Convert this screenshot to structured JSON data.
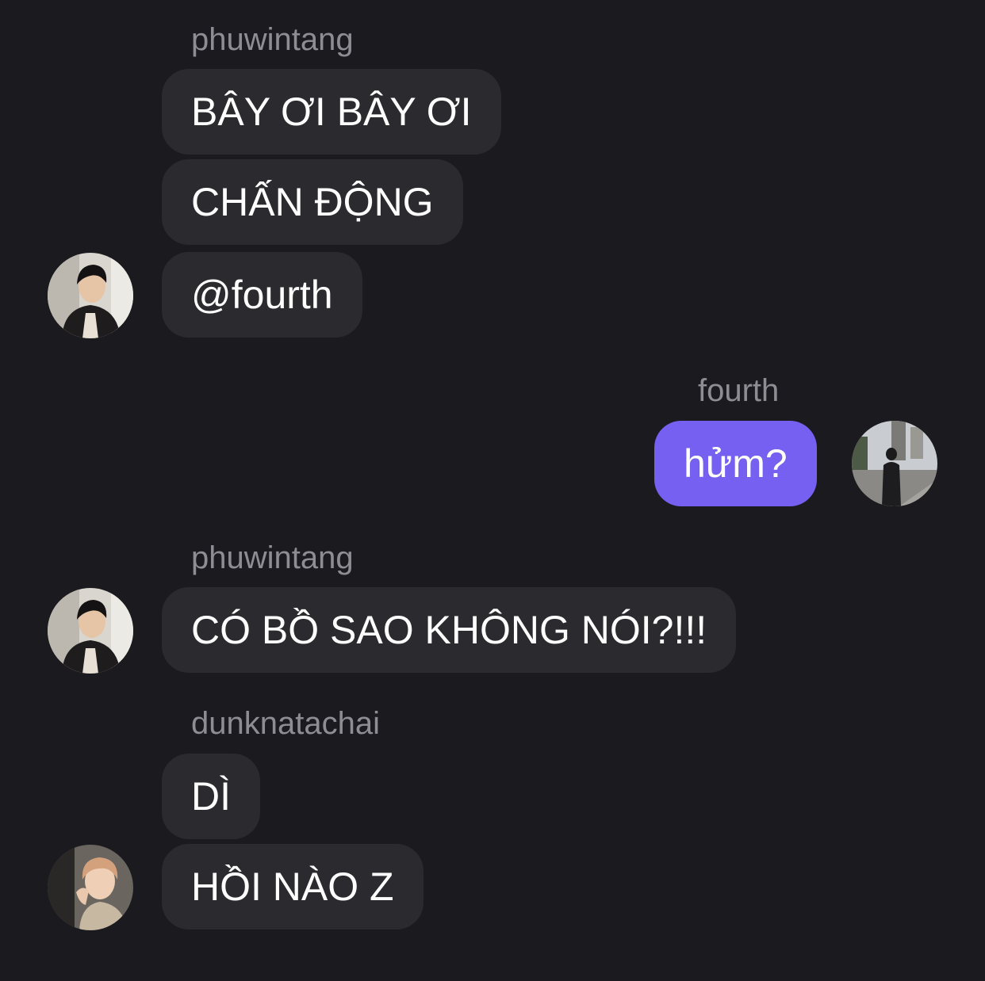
{
  "messages": [
    {
      "sender": "phuwintang",
      "bubbles": [
        "BÂY ƠI BÂY ƠI",
        "CHẤN ĐỘNG",
        "@fourth"
      ],
      "avatar_icon": "user-avatar-phuwintang-icon"
    },
    {
      "sender": "fourth",
      "is_self": true,
      "bubbles": [
        "hửm?"
      ],
      "avatar_icon": "user-avatar-fourth-icon"
    },
    {
      "sender": "phuwintang",
      "bubbles": [
        "CÓ BỒ SAO KHÔNG NÓI?!!!"
      ],
      "avatar_icon": "user-avatar-phuwintang-icon"
    },
    {
      "sender": "dunknatachai",
      "bubbles": [
        "DÌ",
        "HỒI NÀO Z"
      ],
      "avatar_icon": "user-avatar-dunknatachai-icon"
    }
  ],
  "colors": {
    "background": "#1b1a1e",
    "incoming_bubble": "#2b2a2f",
    "outgoing_bubble": "#7560f1",
    "sender_name": "#8e8d93",
    "text": "#ffffff"
  }
}
